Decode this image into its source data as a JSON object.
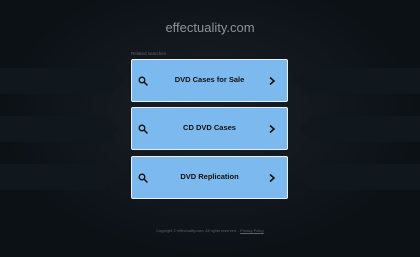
{
  "header": {
    "site_title": "effectuality.com"
  },
  "related_label": "Related searches",
  "cards": [
    {
      "label": "DVD Cases for Sale",
      "icon": "search-icon",
      "arrow": "chevron-right-icon"
    },
    {
      "label": "CD DVD Cases",
      "icon": "search-icon",
      "arrow": "chevron-right-icon"
    },
    {
      "label": "DVD Replication",
      "icon": "search-icon",
      "arrow": "chevron-right-icon"
    }
  ],
  "footer": {
    "copyright": "Copyright © effectuality.com.  All rights reserved.",
    "privacy_link": "Privacy Policy"
  },
  "colors": {
    "background": "#0c1116",
    "card": "#7cb9ef",
    "card_border": "#e8f1f8",
    "decor_arrow": "#10181d"
  }
}
